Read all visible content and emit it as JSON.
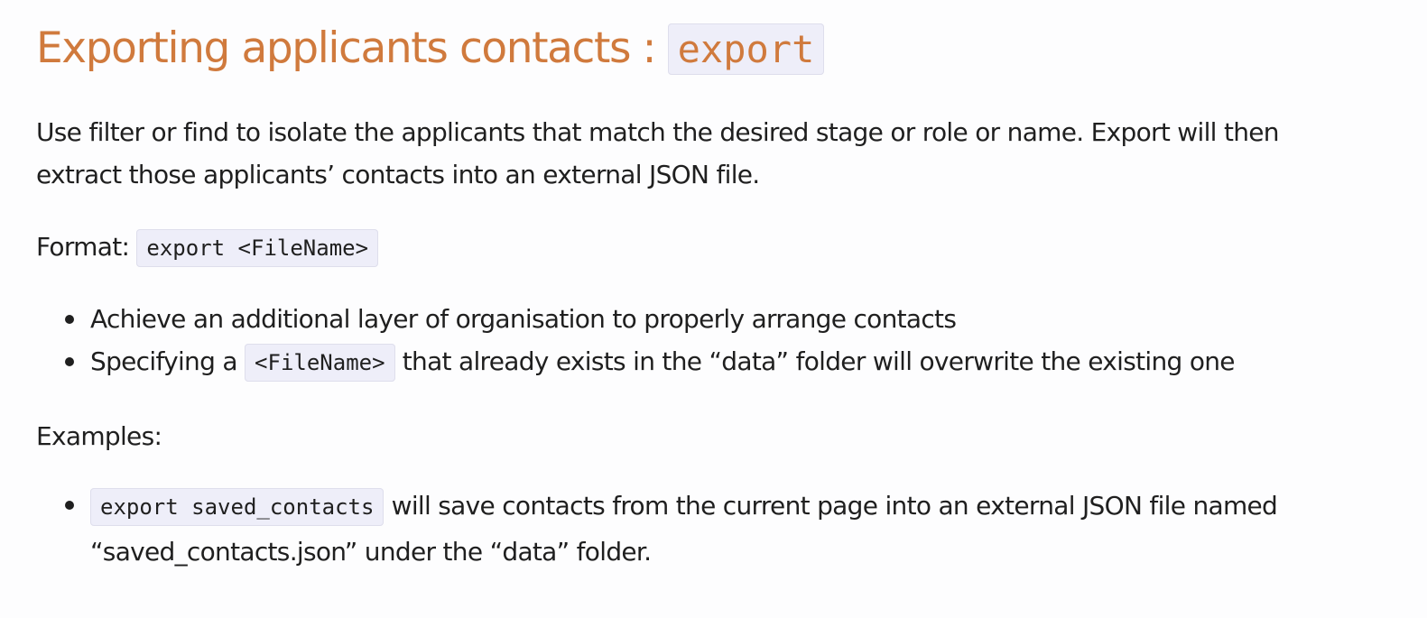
{
  "heading": {
    "text": "Exporting applicants contacts : ",
    "command": "export"
  },
  "intro": {
    "line1": "Use filter or find to isolate the applicants that match the desired stage or role or name. Export will then",
    "line2": "extract those applicants’ contacts into an external JSON file."
  },
  "format": {
    "label": "Format: ",
    "code": "export <FileName>"
  },
  "notes": {
    "item1": "Achieve an additional layer of organisation to properly arrange contacts",
    "item2_before": "Specifying a ",
    "item2_code": "<FileName>",
    "item2_after": " that already exists in the “data” folder will overwrite the existing one"
  },
  "examples": {
    "label": "Examples:",
    "item1_code": "export saved_contacts",
    "item1_line1": " will save contacts from the current page into an external JSON file named",
    "item1_line2": "“saved_contacts.json” under the “data” folder."
  },
  "colors": {
    "heading": "#d07a3d",
    "text": "#1f1f1f",
    "code_background": "#eeeef9",
    "page_background": "#fdfdfe"
  }
}
